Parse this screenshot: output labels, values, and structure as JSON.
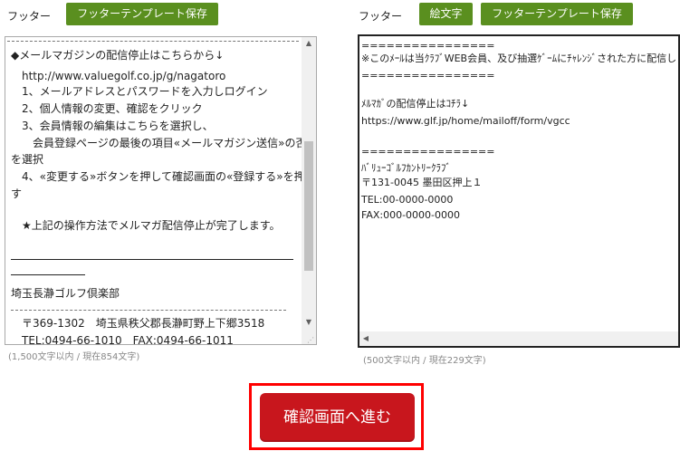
{
  "left_panel": {
    "label": "フッター",
    "save_button": "フッターテンプレート保存",
    "lines": [
      "◆メールマガジンの配信停止はこちらから↓",
      "　http://www.valuegolf.co.jp/g/nagatoro",
      "　1、メールアドレスとパスワードを入力しログイン",
      "　2、個人情報の変更、確認をクリック",
      "　3、会員情報の編集はこちらを選択し、",
      "　　会員登録ページの最後の項目«メールマガジン送信»の否",
      "を選択",
      "　4、«変更する»ボタンを押して確認画面の«登録する»を押",
      "す",
      "",
      "　★上記の操作方法でメルマガ配信停止が完了します。",
      "",
      "",
      "",
      "埼玉長瀞ゴルフ倶楽部",
      "",
      "　〒369-1302　埼玉県秩父郡長瀞町野上下郷3518",
      "　TEL:0494-66-1010　FAX:0494-66-1011"
    ],
    "char_count": "(1,500文字以内 / 現在854文字)"
  },
  "right_panel": {
    "label": "フッター",
    "emoji_button": "絵文字",
    "save_button": "フッターテンプレート保存",
    "lines": [
      "================",
      "※このﾒｰﾙは当ｸﾗﾌﾞWEB会員、及び抽選ｹﾞｰﾑにﾁｬﾚﾝｼﾞされた方に配信し",
      "================",
      "",
      "ﾒﾙﾏｶﾞの配信停止はｺﾁﾗ↓",
      "https://www.glf.jp/home/mailoff/form/vgcc",
      "",
      "================",
      "ﾊﾞﾘｭｰｺﾞﾙﾌｶﾝﾄﾘｰｸﾗﾌﾞ",
      "〒131-0045 墨田区押上１",
      "TEL:00-0000-0000",
      "FAX:000-0000-0000"
    ],
    "char_count": "(500文字以内 / 現在229文字)"
  },
  "confirm_button": "確認画面へ進む",
  "colors": {
    "green_button": "#5a8f1f",
    "confirm_red": "#c8161d",
    "highlight_border": "#ff0000"
  }
}
